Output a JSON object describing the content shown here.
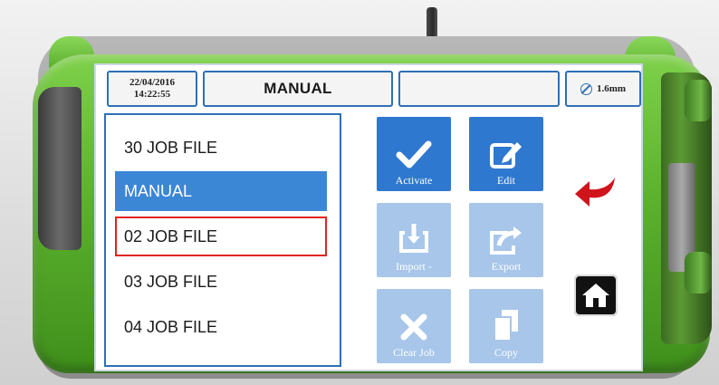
{
  "status_bar": {
    "date": "22/04/2016",
    "time": "14:22:55",
    "mode": "MANUAL",
    "blank_field": "",
    "measurement": "1.6mm"
  },
  "job_list": {
    "items": [
      {
        "label": "30 JOB FILE",
        "state": "normal"
      },
      {
        "label": "MANUAL",
        "state": "selected"
      },
      {
        "label": "02 JOB FILE",
        "state": "highlighted"
      },
      {
        "label": "03 JOB FILE",
        "state": "normal"
      },
      {
        "label": "04 JOB FILE",
        "state": "normal"
      }
    ]
  },
  "actions": {
    "activate": {
      "label": "Activate",
      "icon": "check-icon",
      "enabled": true
    },
    "edit": {
      "label": "Edit",
      "icon": "edit-icon",
      "enabled": true
    },
    "import": {
      "label": "Import -",
      "icon": "import-icon",
      "enabled": false
    },
    "export": {
      "label": "Export",
      "icon": "export-icon",
      "enabled": false
    },
    "clear_job": {
      "label": "Clear Job",
      "icon": "clear-icon",
      "enabled": false
    },
    "copy": {
      "label": "Copy",
      "icon": "copy-icon",
      "enabled": false
    }
  },
  "nav": {
    "back_icon": "back-arrow-icon",
    "home_icon": "home-icon"
  },
  "colors": {
    "accent_blue": "#2f78cf",
    "selected_row": "#3c86d6",
    "highlight_border": "#e02424",
    "device_green": "#5cb22d",
    "back_arrow_red": "#d0141c"
  }
}
